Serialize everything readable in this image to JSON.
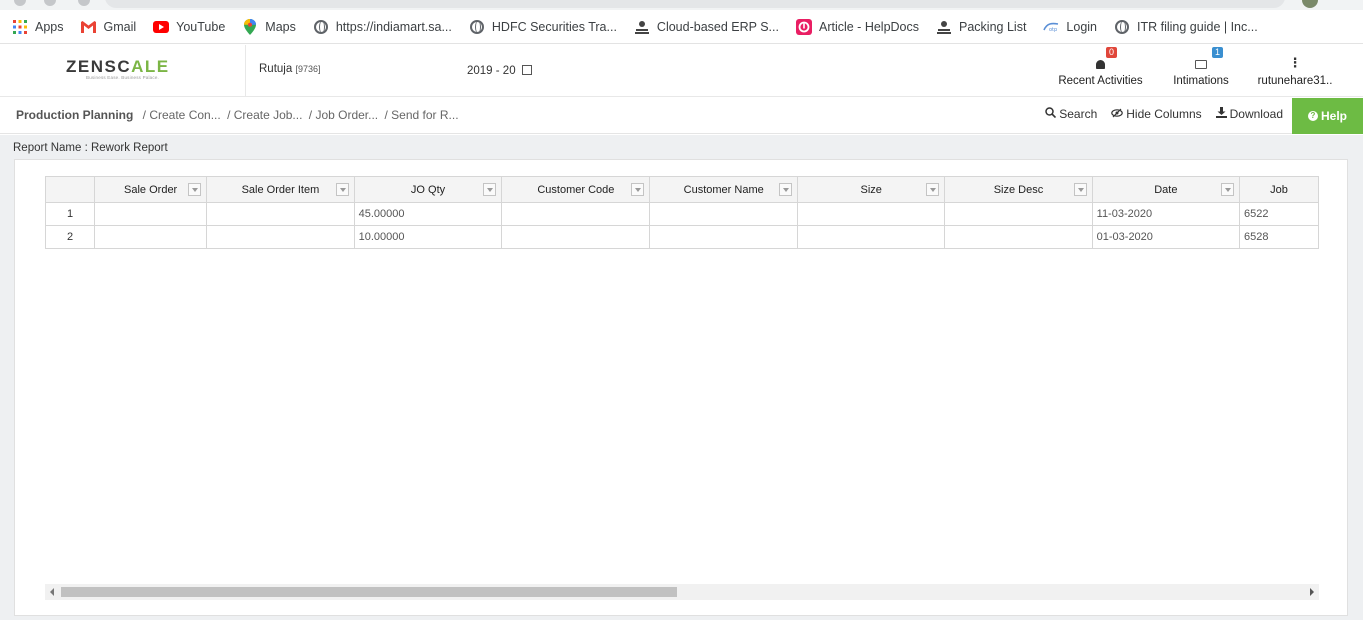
{
  "bookmarks": [
    {
      "label": "Apps",
      "icon": "apps-grid-icon"
    },
    {
      "label": "Gmail",
      "icon": "gmail-icon"
    },
    {
      "label": "YouTube",
      "icon": "youtube-icon"
    },
    {
      "label": "Maps",
      "icon": "maps-pin-icon"
    },
    {
      "label": "https://indiamart.sa...",
      "icon": "globe-icon"
    },
    {
      "label": "HDFC Securities Tra...",
      "icon": "globe-icon"
    },
    {
      "label": "Cloud-based ERP S...",
      "icon": "erp-icon"
    },
    {
      "label": "Article - HelpDocs",
      "icon": "helpdocs-icon"
    },
    {
      "label": "Packing List",
      "icon": "erp-icon"
    },
    {
      "label": "Login",
      "icon": "login-icon"
    },
    {
      "label": "ITR filing guide | Inc...",
      "icon": "globe-icon"
    }
  ],
  "header": {
    "logo_text_a": "ZENSC",
    "logo_text_b": "A",
    "logo_text_c": "LE",
    "logo_tagline": "Business Ease. Business Palace.",
    "user": "Rutuja",
    "user_code": "[9736]",
    "financial_year": "2019 - 20",
    "recent_activities_label": "Recent Activities",
    "recent_activities_count": "0",
    "intimations_label": "Intimations",
    "intimations_count": "1",
    "account_label": "rutunehare31.."
  },
  "breadcrumb": {
    "root": "Production Planning",
    "items": [
      "/ Create Con...",
      "/ Create Job...",
      "/ Job Order...",
      "/ Send for R..."
    ]
  },
  "toolbar": {
    "search_label": "Search",
    "hide_columns_label": "Hide Columns",
    "download_label": "Download",
    "help_label": "Help"
  },
  "report": {
    "name_label": "Report Name : Rework Report",
    "columns": [
      "Sale Order",
      "Sale Order Item",
      "JO Qty",
      "Customer Code",
      "Customer Name",
      "Size",
      "Size Desc",
      "Date",
      "Job"
    ],
    "rows": [
      {
        "rn": "1",
        "cells": [
          "",
          "",
          "45.00000",
          "",
          "",
          "",
          "",
          "11-03-2020",
          "6522"
        ]
      },
      {
        "rn": "2",
        "cells": [
          "",
          "",
          "10.00000",
          "",
          "",
          "",
          "",
          "01-03-2020",
          "6528"
        ]
      }
    ]
  },
  "colors": {
    "accent_green": "#6dbb44",
    "badge_red": "#e0463a",
    "badge_blue": "#3a8fd0"
  }
}
